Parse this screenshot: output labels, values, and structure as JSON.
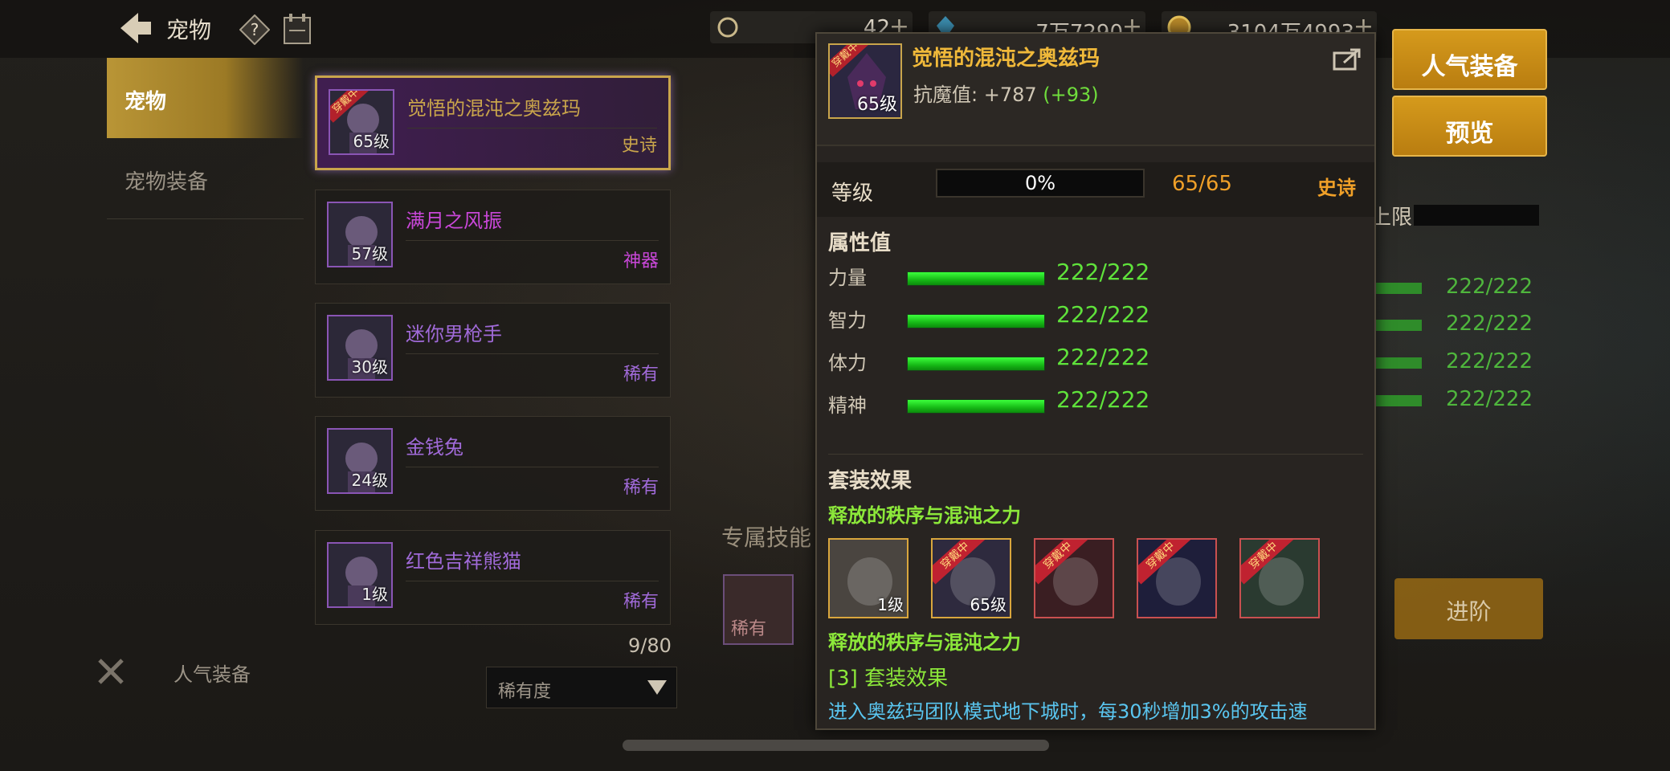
{
  "header": {
    "title": "宠物",
    "resources": [
      {
        "value": "42",
        "icon": "gem-icon"
      },
      {
        "value": "7万7290",
        "icon": "crystal-icon"
      },
      {
        "value": "3104万4993",
        "icon": "gold-coin-icon"
      }
    ]
  },
  "sidebar": {
    "tabs": [
      {
        "label": "宠物",
        "active": true
      },
      {
        "label": "宠物装备",
        "active": false
      }
    ],
    "popular_label": "人气装备"
  },
  "pet_list": {
    "items": [
      {
        "name": "觉悟的混沌之奥兹玛",
        "level": "65级",
        "rarity": "史诗",
        "name_color": "#c9a54b",
        "rarity_color": "#c9a54b",
        "worn": true,
        "worn_label": "穿戴中"
      },
      {
        "name": "满月之风振",
        "level": "57级",
        "rarity": "神器",
        "name_color": "#c847d8",
        "rarity_color": "#c847d8",
        "worn": false
      },
      {
        "name": "迷你男枪手",
        "level": "30级",
        "rarity": "稀有",
        "name_color": "#a06ad8",
        "rarity_color": "#a06ad8",
        "worn": false
      },
      {
        "name": "金钱兔",
        "level": "24级",
        "rarity": "稀有",
        "name_color": "#a06ad8",
        "rarity_color": "#a06ad8",
        "worn": false
      },
      {
        "name": "红色吉祥熊猫",
        "level": "1级",
        "rarity": "稀有",
        "name_color": "#a06ad8",
        "rarity_color": "#a06ad8",
        "worn": false
      }
    ],
    "count": "9/80",
    "sort_label": "稀有度"
  },
  "background": {
    "exclusive_skill_title": "专属技能",
    "skill_rarity": "稀有",
    "upper_label": "上限",
    "stat_values": [
      "222/222",
      "222/222",
      "222/222",
      "222/222"
    ]
  },
  "right_buttons": {
    "popular": "人气装备",
    "preview": "预览",
    "advance": "进阶"
  },
  "tooltip": {
    "name": "觉悟的混沌之奥兹玛",
    "worn_label": "穿戴中",
    "icon_level": "65级",
    "stat_label": "抗魔值:",
    "stat_value": "+787",
    "stat_bonus": "(+93)",
    "level_label": "等级",
    "level_progress_text": "0%",
    "level_progress": 0,
    "level_value": "65/65",
    "rarity": "史诗",
    "attributes_title": "属性值",
    "attributes": [
      {
        "label": "力量",
        "value": "222/222",
        "fill": 1.0
      },
      {
        "label": "智力",
        "value": "222/222",
        "fill": 1.0
      },
      {
        "label": "体力",
        "value": "222/222",
        "fill": 1.0
      },
      {
        "label": "精神",
        "value": "222/222",
        "fill": 1.0
      }
    ],
    "set_title": "套装效果",
    "set_name": "释放的秩序与混沌之力",
    "set_items": [
      {
        "level": "1级",
        "worn": false
      },
      {
        "level": "65级",
        "worn": true
      },
      {
        "level": "",
        "worn": true
      },
      {
        "level": "",
        "worn": true
      },
      {
        "level": "",
        "worn": true
      }
    ],
    "set_name_2": "释放的秩序与混沌之力",
    "set_bonus_title": "[3] 套装效果",
    "set_description": "进入奥兹玛团队模式地下城时，每30秒增加3%的攻击速"
  }
}
